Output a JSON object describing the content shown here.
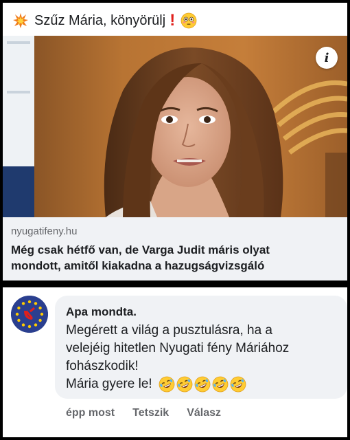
{
  "post": {
    "text": "Szűz Mária, könyörülj",
    "emoji_start": "collision-icon",
    "emoji_middle": "exclamation-icon",
    "emoji_end": "flushed-face-icon"
  },
  "link_preview": {
    "domain": "nyugatifeny.hu",
    "title": "Még csak hétfő van, de Varga Judit máris olyat mondott, amitől kiakadna a hazugságvizsgáló",
    "title_line1": "Még csak hétfő van, de Varga Judit máris olyat",
    "title_line2": "mondott, amitől kiakadna a hazugságvizsgáló",
    "info_label": "i"
  },
  "comment": {
    "author": "Apa mondta.",
    "lines": [
      "Megérett a világ a pusztulásra, ha a",
      "velejéig hitetlen Nyugati fény Máriához",
      "fohászkodik!",
      "Mária gyere le!"
    ],
    "reaction_emoji": "rolling-on-floor-laughing-icon",
    "reaction_count": 5,
    "timestamp": "épp most",
    "like_label": "Tetszik",
    "reply_label": "Válasz"
  },
  "colors": {
    "accent_red": "#e0201c",
    "text_dark": "#1c1e21",
    "text_muted": "#65676b",
    "bubble_bg": "#f0f2f5",
    "avatar_blue": "#2a3f8f",
    "eu_star_yellow": "#ffcc00"
  }
}
